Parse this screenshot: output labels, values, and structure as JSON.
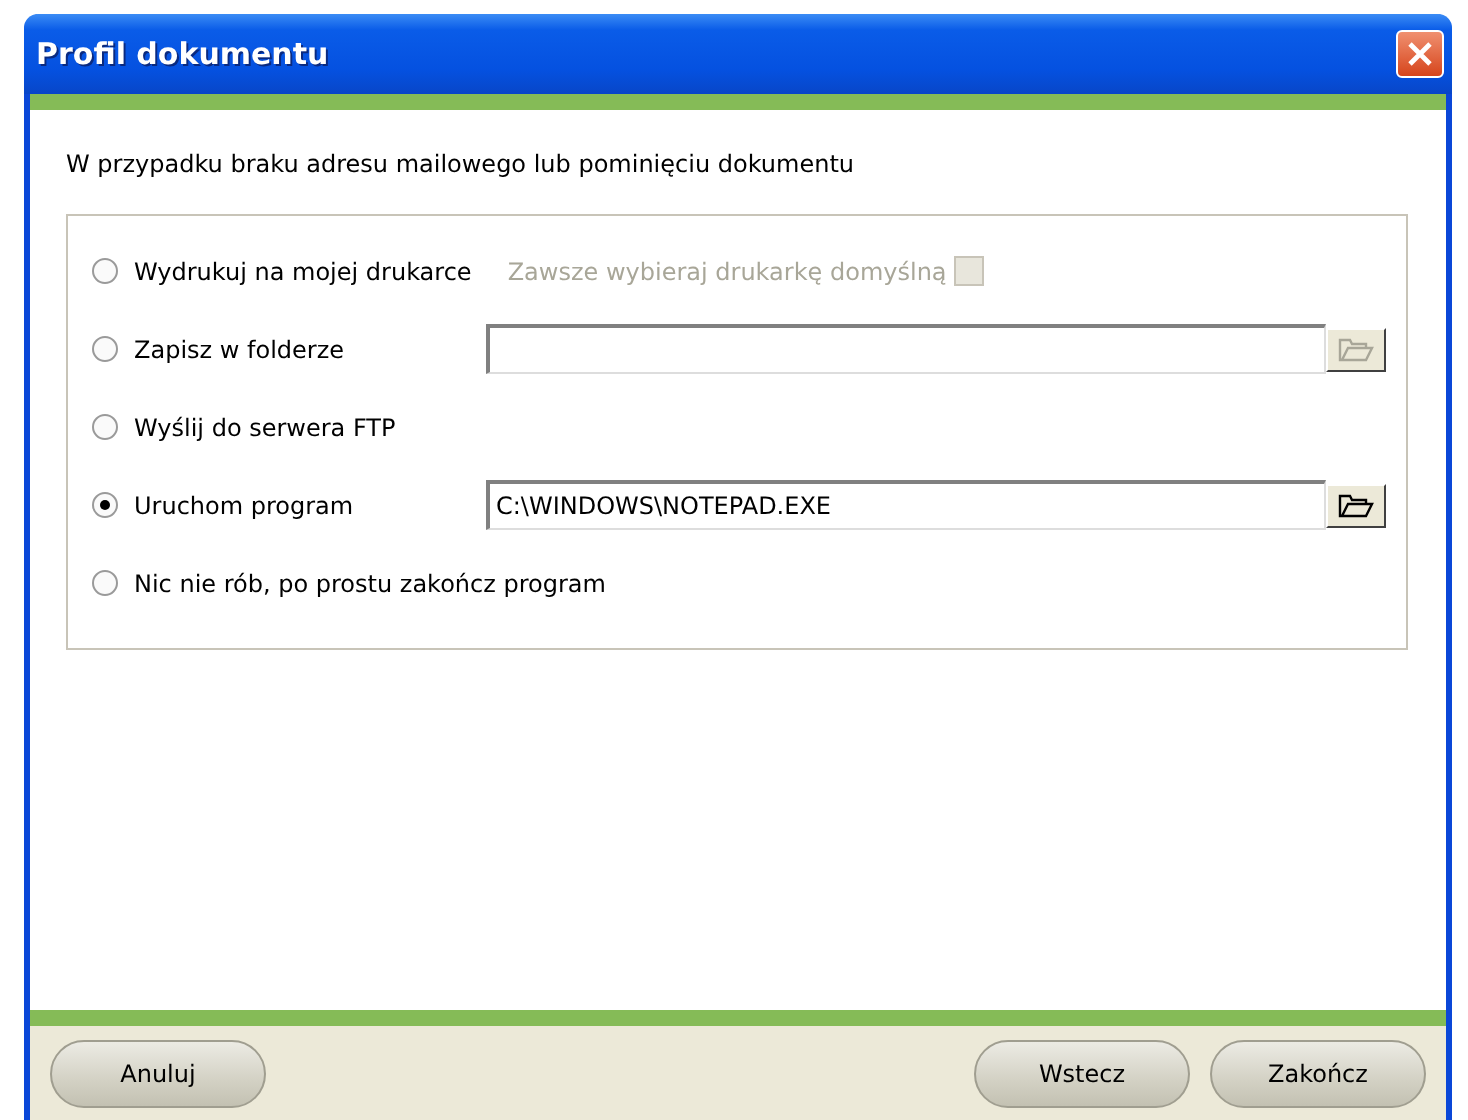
{
  "window": {
    "title": "Profil dokumentu"
  },
  "intro": "W przypadku braku adresu mailowego lub pominięciu dokumentu",
  "options": [
    {
      "kind": "checkbox",
      "label": "Wydrukuj na mojej drukarce",
      "selected": false,
      "checkbox_label": "Zawsze wybieraj drukarkę domyślną",
      "checked": false,
      "disabled": true
    },
    {
      "kind": "path",
      "label": "Zapisz w folderze",
      "selected": false,
      "disabled": true
    },
    {
      "kind": "plain",
      "label": "Wyślij do serwera FTP",
      "selected": false
    },
    {
      "kind": "path",
      "label": "Uruchom program",
      "selected": true,
      "value": "C:\\WINDOWS\\NOTEPAD.EXE",
      "disabled": false
    },
    {
      "kind": "plain",
      "label": "Nic nie rób, po prostu zakończ program",
      "selected": false
    }
  ],
  "buttons_left": [
    "Anuluj"
  ],
  "buttons_right": [
    "Wstecz",
    "Zakończ"
  ]
}
